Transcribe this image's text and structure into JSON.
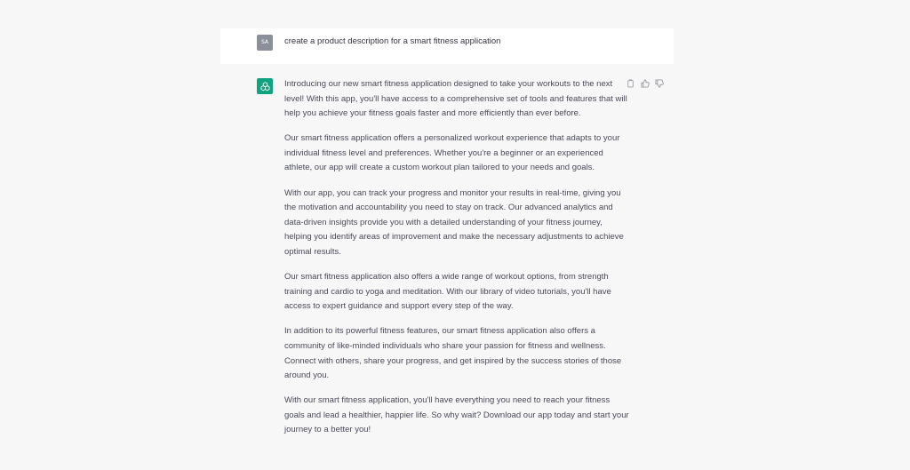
{
  "user_message": {
    "avatar_initials": "SA",
    "text": "create a product description for a smart fitness application"
  },
  "assistant_message": {
    "avatar_icon": "openai-logo-icon",
    "paragraphs": [
      [
        "Introducing our new smart fitness application designed to take your workouts to the next",
        "level! With this app, you'll have access to a comprehensive set of tools and features that will",
        "help you achieve your fitness goals faster and more efficiently than ever before."
      ],
      [
        "Our smart fitness application offers a personalized workout experience that adapts to your",
        "individual fitness level and preferences. Whether you're a beginner or an experienced",
        "athlete, our app will create a custom workout plan tailored to your needs and goals."
      ],
      [
        "With our app, you can track your progress and monitor your results in real-time, giving you",
        "the motivation and accountability you need to stay on track. Our advanced analytics and",
        "data-driven insights provide you with a detailed understanding of your fitness journey,",
        "helping you identify areas of improvement and make the necessary adjustments to achieve",
        "optimal results."
      ],
      [
        "Our smart fitness application also offers a wide range of workout options, from strength",
        "training and cardio to yoga and meditation. With our library of video tutorials, you'll have",
        "access to expert guidance and support every step of the way."
      ],
      [
        "In addition to its powerful fitness features, our smart fitness application also offers a",
        "community of like-minded individuals who share your passion for fitness and wellness.",
        "Connect with others, share your progress, and get inspired by the success stories of those",
        "around you."
      ],
      [
        "With our smart fitness application, you'll have everything you need to reach your fitness",
        "goals and lead a healthier, happier life. So why wait? Download our app today and start your",
        "journey to a better you!"
      ]
    ]
  },
  "actions": {
    "icons": [
      "copy-icon",
      "thumbs-up-icon",
      "thumbs-down-icon"
    ]
  },
  "colors": {
    "page_bg": "#f7f7f8",
    "user_row_bg": "#ffffff",
    "assistant_accent": "#10a37f",
    "user_avatar": "#8a8f99"
  }
}
